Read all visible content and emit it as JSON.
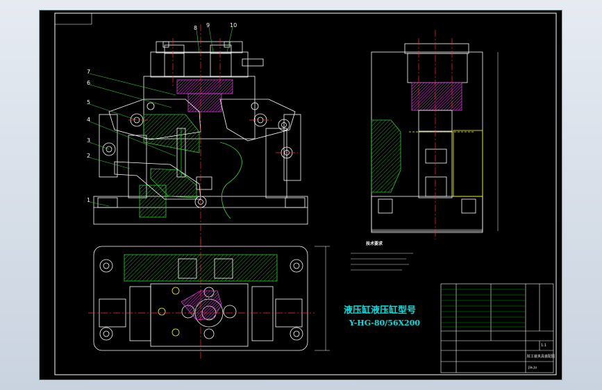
{
  "title": {
    "chinese": "液压缸液压缸型号",
    "model": "Y-HG-80/56X200"
  },
  "tech_requirements": {
    "heading": "技术要求"
  },
  "part_numbers": [
    "1",
    "2",
    "3",
    "4",
    "5",
    "6",
    "7",
    "8",
    "9",
    "10"
  ],
  "title_block": {
    "drawing_name": "缸工装夹具装配图",
    "drawing_no": "jia.ju",
    "ratio": "1:1"
  },
  "colors": {
    "background": "#000000",
    "outline": "#ffffff",
    "center_line": "#ff3030",
    "hatch": "#33cc33",
    "accent": "#d040d0",
    "dimension": "#ffffff",
    "text_accent": "#00e0e0",
    "leader": "#ffff66"
  }
}
